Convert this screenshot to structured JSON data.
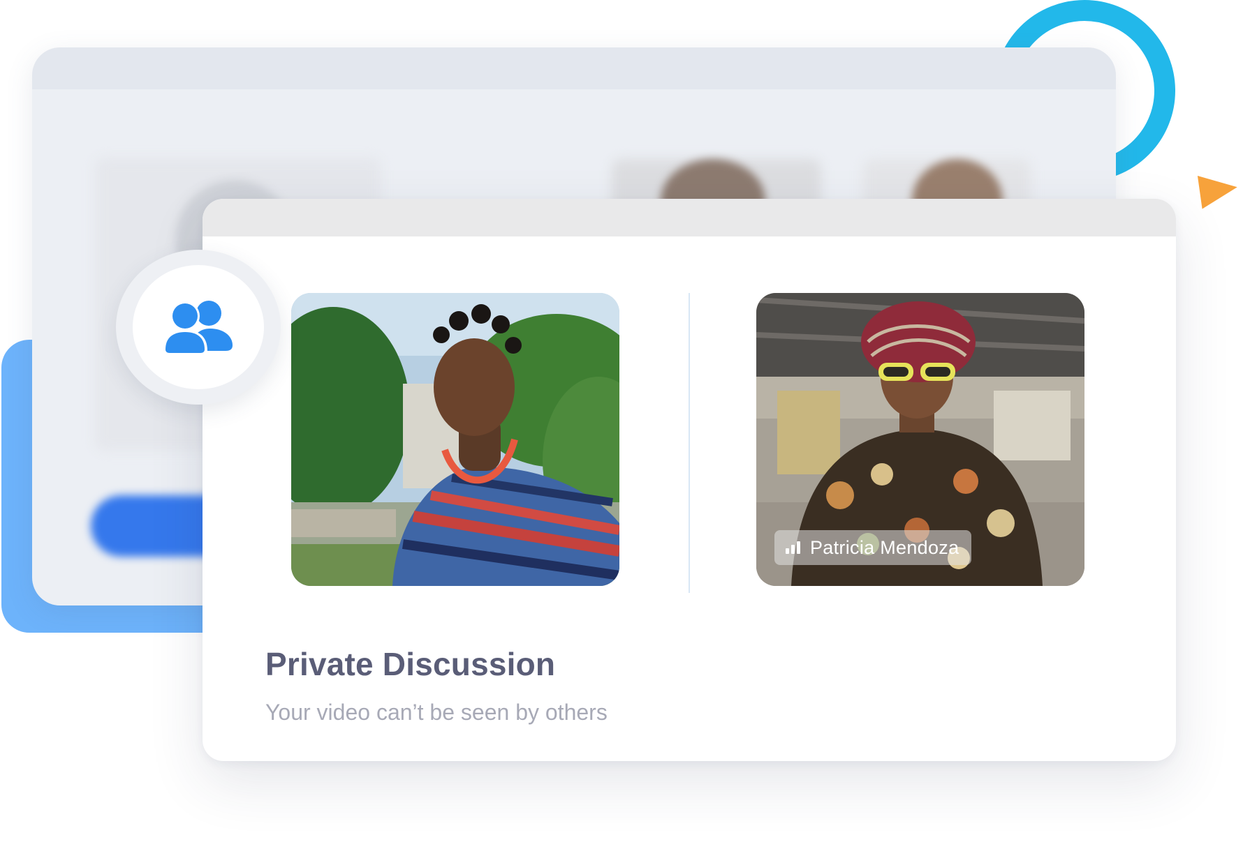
{
  "background_window": {
    "blurred_button_label": ""
  },
  "main_window": {
    "participants": [
      {
        "name": "",
        "signal_icon": false
      },
      {
        "name": "Patricia Mendoza",
        "signal_icon": true
      }
    ],
    "title": "Private Discussion",
    "subtitle": "Your video can’t be seen by others"
  },
  "badge": {
    "icon": "group-users-icon",
    "color": "#2d8ef0"
  },
  "colors": {
    "ring": "#22b8ea",
    "triangle": "#f7a23b",
    "blue_card": "#6db3fb",
    "title_text": "#5a5d77",
    "subtitle_text": "#a7a9b6"
  }
}
